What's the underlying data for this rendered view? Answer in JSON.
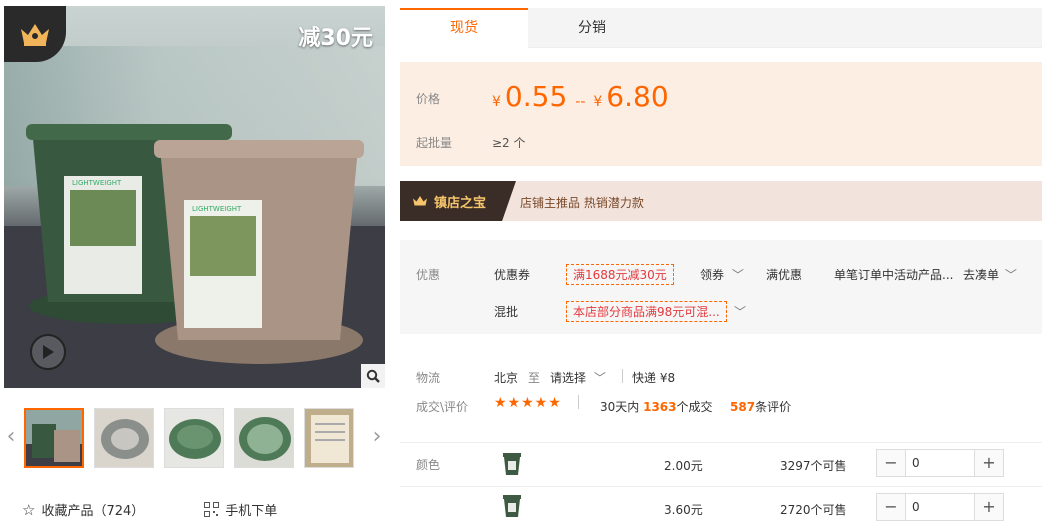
{
  "gallery": {
    "promo_text": "减30元",
    "pot_label": "LIGHTWEIGHT"
  },
  "bottom_links": {
    "favorite_label": "收藏产品（724）",
    "mobile_label": "手机下单"
  },
  "tabs": [
    {
      "label": "现货",
      "active": true
    },
    {
      "label": "分销",
      "active": false
    }
  ],
  "price": {
    "label": "价格",
    "currency": "¥",
    "min": "0.55",
    "separator": "--",
    "max": "6.80",
    "min_order_label": "起批量",
    "min_order_value": "≥2 个"
  },
  "shop_bar": {
    "badge": "镇店之宝",
    "text": "店铺主推品  热销潜力款"
  },
  "promotions": {
    "label": "优惠",
    "coupon_label": "优惠券",
    "coupon_tag": "满1688元减30元",
    "claim_label": "领券",
    "full_discount_label": "满优惠",
    "full_discount_text": "单笔订单中活动产品...",
    "go_label": "去凑单",
    "mix_label": "混批",
    "mix_tag": "本店部分商品满98元可混..."
  },
  "logistics": {
    "label": "物流",
    "from": "北京",
    "to_word": "至",
    "select_placeholder": "请选择",
    "express": "快递 ¥8",
    "deals_label": "成交\\评价",
    "stars": "★★★★★",
    "deals_prefix": "30天内",
    "deals_count": "1363",
    "deals_suffix": "个成交",
    "reviews_count": "587",
    "reviews_suffix": "条评价"
  },
  "sku": {
    "label": "颜色",
    "rows": [
      {
        "price": "2.00元",
        "stock": "3297个可售",
        "qty": "0"
      },
      {
        "price": "3.60元",
        "stock": "2720个可售",
        "qty": "0"
      }
    ]
  },
  "colors": {
    "accent": "#ff6600",
    "price_bg": "#fdeee3",
    "shop_bar_bg": "#f2e3dc",
    "shop_flag_bg": "#3a2d28"
  }
}
